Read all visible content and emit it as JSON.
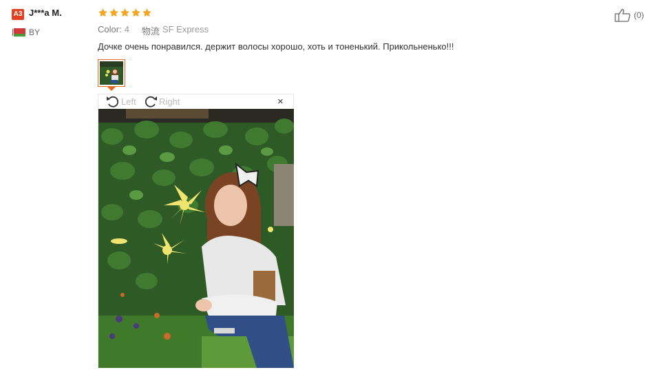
{
  "reviewer": {
    "badge": "A3",
    "name": "J***a M.",
    "country": "BY"
  },
  "rating": {
    "stars": 5,
    "max": 5,
    "color": "#f5a623"
  },
  "meta": {
    "color_label": "Color:",
    "color_value": "4",
    "shipping_label": "物流",
    "shipping_value": "SF Express"
  },
  "review_text": "Дочке очень понравился. держит волосы хорошо, хоть и тоненький. Прикольненько!!!",
  "helpful": {
    "count": "(0)"
  },
  "viewer": {
    "rotate_left": "Left",
    "rotate_right": "Right",
    "close": "×"
  },
  "colors": {
    "accent": "#e86a1e",
    "badge": "#e3401f"
  }
}
